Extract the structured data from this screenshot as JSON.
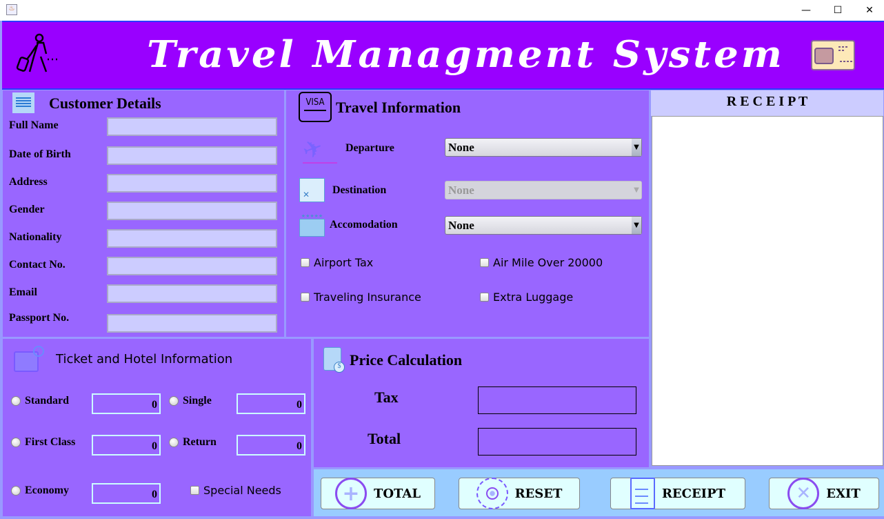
{
  "window": {
    "title": "",
    "controls": [
      "—",
      "☐",
      "✕"
    ]
  },
  "header": {
    "title": "Travel Managment System"
  },
  "customer": {
    "title": "Customer Details",
    "fields": [
      {
        "label": "Full Name",
        "value": ""
      },
      {
        "label": "Date of Birth",
        "value": ""
      },
      {
        "label": "Address",
        "value": ""
      },
      {
        "label": "Gender",
        "value": ""
      },
      {
        "label": "Nationality",
        "value": ""
      },
      {
        "label": "Contact No.",
        "value": ""
      },
      {
        "label": "Email",
        "value": ""
      },
      {
        "label": "Passport No.",
        "value": ""
      }
    ]
  },
  "travel": {
    "title": "Travel Information",
    "departure": {
      "label": "Departure",
      "value": "None"
    },
    "destination": {
      "label": "Destination",
      "value": "None",
      "enabled": false
    },
    "accomodation": {
      "label": "Accomodation",
      "value": "None"
    },
    "checkboxes": [
      {
        "label": "Airport Tax",
        "checked": false
      },
      {
        "label": "Air Mile Over 20000",
        "checked": false
      },
      {
        "label": "Traveling Insurance",
        "checked": false
      },
      {
        "label": "Extra Luggage",
        "checked": false
      }
    ]
  },
  "ticket": {
    "title": "Ticket and Hotel Information",
    "options": [
      {
        "label": "Standard",
        "value": "0"
      },
      {
        "label": "Single",
        "value": "0"
      },
      {
        "label": "First Class",
        "value": "0"
      },
      {
        "label": "Return",
        "value": "0"
      },
      {
        "label": "Economy",
        "value": "0"
      }
    ],
    "special_needs": "Special Needs"
  },
  "price": {
    "title": "Price Calculation",
    "tax_label": "Tax",
    "tax_value": "",
    "total_label": "Total",
    "total_value": ""
  },
  "receipt": {
    "title": "R E C E I P T",
    "content": ""
  },
  "buttons": {
    "total": "TOTAL",
    "reset": "RESET",
    "receipt": "RECEIPT",
    "exit": "EXIT"
  },
  "colors": {
    "header": "#9900ff",
    "panel": "#9966ff",
    "field": "#ccccff",
    "button_bar": "#99ccff",
    "button": "#e0ffff"
  }
}
